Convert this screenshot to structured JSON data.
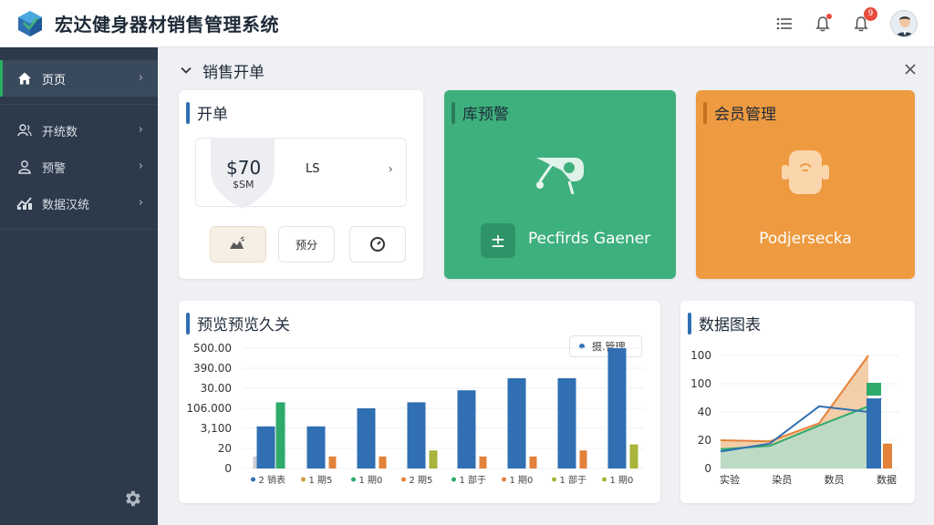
{
  "app": {
    "title": "宏达健身器材销售管理系统"
  },
  "header": {
    "notification_badge": "9",
    "icons": [
      "list-icon",
      "bell-icon",
      "alert-bell-icon",
      "avatar"
    ]
  },
  "sidebar": {
    "items": [
      {
        "label": "页页",
        "icon": "home-icon",
        "active": true
      },
      {
        "label": "开统数",
        "icon": "users-icon",
        "active": false
      },
      {
        "label": "预警",
        "icon": "user-icon",
        "active": false
      },
      {
        "label": "数据汉统",
        "icon": "data-icon",
        "active": false
      }
    ],
    "settings_icon": "gear-icon"
  },
  "page": {
    "title": "销售开单"
  },
  "cards": {
    "order": {
      "title": "开单",
      "price": "$70",
      "price_sub": "$SM",
      "label": "LS",
      "buttons": [
        "",
        "预分",
        ""
      ]
    },
    "stock_alert": {
      "title": "库预警",
      "label": "Pecfirds Gaener",
      "button_icon": "plus-minus-icon"
    },
    "member": {
      "title": "会员管理",
      "label": "Podjersecka"
    },
    "bar_chart": {
      "title": "预览预览久关",
      "legend_label": "摄.管理"
    },
    "area_chart": {
      "title": "数据图表"
    }
  },
  "colors": {
    "sidebar_bg": "#2c3a4b",
    "accent_green": "#3eb07e",
    "accent_orange": "#ee9a40",
    "accent_blue": "#2f6fb2"
  },
  "chart_data": [
    {
      "type": "bar",
      "y_tick_labels": [
        "500.00",
        "390.00",
        "30.00",
        "106.000",
        "3,100",
        "20",
        "0"
      ],
      "categories": [
        "2 销表",
        "1 期5",
        "1 期0",
        "2 期5",
        "1 部于",
        "1 期0",
        "1 部于",
        "1 期0"
      ],
      "legend_visible": "top-right",
      "series": [
        {
          "values": [
            7,
            8,
            0,
            0,
            0,
            0,
            0,
            0
          ]
        },
        {
          "values": [
            0,
            0,
            0,
            0,
            0,
            0,
            0,
            0
          ]
        }
      ],
      "bars": {
        "blue": [
          7,
          7,
          10,
          11,
          13,
          15,
          15,
          20
        ],
        "green": [
          11,
          0,
          0,
          0,
          0,
          0,
          0,
          0
        ],
        "orange": [
          0,
          2,
          2,
          2,
          2,
          2,
          3,
          0
        ],
        "olive": [
          0,
          0,
          0,
          3,
          0,
          0,
          0,
          4
        ],
        "gray": [
          2,
          0,
          0,
          0,
          0,
          0,
          0,
          0
        ]
      },
      "ylim": [
        0,
        20
      ]
    },
    {
      "type": "area",
      "y_tick_labels": [
        "100",
        "100",
        "40",
        "20",
        "0"
      ],
      "categories": [
        "实验",
        "染员",
        "数员",
        "数据"
      ],
      "series_lines": {
        "orange": [
          25,
          24,
          40,
          100,
          0
        ],
        "blue": [
          15,
          22,
          55,
          50,
          62
        ],
        "green": [
          17,
          20,
          38,
          55,
          58
        ]
      },
      "end_bars": {
        "green": 100,
        "blue": 62,
        "orange": 22
      },
      "ylim": [
        0,
        100
      ]
    }
  ]
}
